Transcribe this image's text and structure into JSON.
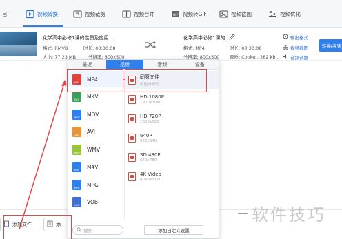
{
  "tabs": [
    {
      "label": "目"
    },
    {
      "label": "视频转换"
    },
    {
      "label": "视频裁剪"
    },
    {
      "label": "视频合并"
    },
    {
      "label": "视频转GIF"
    },
    {
      "label": "视频截图"
    },
    {
      "label": "视频优化"
    }
  ],
  "file": {
    "source": {
      "title": "化学高中必修1课的性质及应用 ...",
      "format": "格式: RMVB",
      "duration": "时长: 00:30:08",
      "size": "大小: 77.23 MB",
      "resolution": "分辨率: 800x500"
    },
    "target": {
      "title": "化学高中必修1课的...",
      "format": "格式: MP4",
      "duration": "时长: 00:30:08",
      "resolution": "分辨率: 800x500",
      "channel": "音质: Cooker, 282 kb..."
    },
    "options": [
      "输出格式",
      "视频截图",
      "音频调整"
    ],
    "convert_label": "转换(高速)"
  },
  "bottom": {
    "add_file": "添加文件",
    "add_dir": "添"
  },
  "popup": {
    "tabs": [
      "最近",
      "视频",
      "音频",
      "设备"
    ],
    "active_tab": 1,
    "formats": [
      {
        "label": "MP4",
        "color": "#e0413a"
      },
      {
        "label": "MKV",
        "color": "#3a9e5a"
      },
      {
        "label": "MOV",
        "color": "#2f80ed"
      },
      {
        "label": "AVI",
        "color": "#e8943a"
      },
      {
        "label": "WMV",
        "color": "#9bc23f"
      },
      {
        "label": "M4V",
        "color": "#2f80ed"
      },
      {
        "label": "MPG",
        "color": "#2f80ed"
      },
      {
        "label": "VOB",
        "color": "#3f6fd0"
      }
    ],
    "qualities": [
      {
        "name": "同原文件",
        "sub": "原始分辨率"
      },
      {
        "name": "HD 1080P",
        "sub": "1920x1080"
      },
      {
        "name": "HD 720P",
        "sub": "1080x720"
      },
      {
        "name": "640P",
        "sub": "960x640"
      },
      {
        "name": "SD 480P",
        "sub": "640x480"
      },
      {
        "name": "4K Video",
        "sub": "4096x2160"
      }
    ],
    "search_placeholder": "搜索",
    "custom_label": "添加自定义设置"
  },
  "watermark": "软件技巧",
  "colors": {
    "accent": "#2f80ed",
    "annotation": "#e04848"
  }
}
